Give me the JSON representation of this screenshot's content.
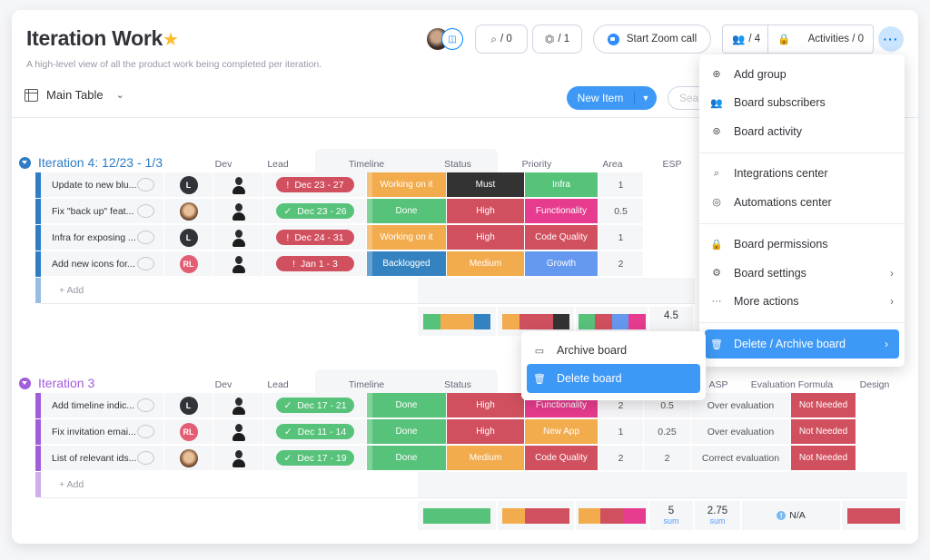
{
  "board": {
    "title": "Iteration Work",
    "description": "A high-level view of all the product work being completed per iteration.",
    "view_label": "Main Table"
  },
  "header": {
    "integrations_count": "/ 0",
    "automations_count": "/ 1",
    "zoom_label": "Start Zoom call",
    "subscribers_count": "/ 4",
    "activities_label": "Activities / 0",
    "new_item_label": "New Item",
    "search_placeholder": "Search"
  },
  "columns": [
    "Dev",
    "Lead",
    "Timeline",
    "Status",
    "Priority",
    "Area",
    "ESP",
    "ASP",
    "Evaluation Formula",
    "Design"
  ],
  "colors": {
    "done": "#57c27a",
    "working": "#f2ab4d",
    "stuck": "#d1505f",
    "backlogged": "#3483c0",
    "must": "#333333",
    "growth": "#6598ef",
    "pink": "#e63b8e",
    "group4": "#2f7dc5",
    "group3": "#a25ddc"
  },
  "groups": [
    {
      "title": "Iteration 4: 12/23 - 1/3",
      "color": "#2f7dc5",
      "add_label": "+ Add",
      "rows": [
        {
          "name": "Update to new blu...",
          "dev": "L",
          "timeline": "Dec 23 - 27",
          "timeline_state": "!",
          "status": "Working on it",
          "priority": "Must",
          "area": "Infra",
          "esp": "1"
        },
        {
          "name": "Fix \"back up\" feat...",
          "dev": "photo",
          "timeline": "Dec 23 - 26",
          "timeline_state": "✓",
          "status": "Done",
          "priority": "High",
          "area": "Functionality",
          "esp": "0.5"
        },
        {
          "name": "Infra for exposing ...",
          "dev": "L",
          "timeline": "Dec 24 - 31",
          "timeline_state": "!",
          "status": "Working on it",
          "priority": "High",
          "area": "Code Quality",
          "esp": "1"
        },
        {
          "name": "Add new icons for...",
          "dev": "RL",
          "timeline": "Jan 1 - 3",
          "timeline_state": "!",
          "status": "Backlogged",
          "priority": "Medium",
          "area": "Growth",
          "esp": "2"
        }
      ],
      "summary": {
        "esp": "4.5"
      }
    },
    {
      "title": "Iteration 3",
      "color": "#a25ddc",
      "add_label": "+ Add",
      "rows": [
        {
          "name": "Add timeline indic...",
          "dev": "L",
          "timeline": "Dec 17 - 21",
          "timeline_state": "✓",
          "status": "Done",
          "priority": "High",
          "area": "Functionality",
          "esp": "2",
          "asp": "0.5",
          "evaluation": "Over evaluation",
          "design": "Not Needed"
        },
        {
          "name": "Fix invitation emai...",
          "dev": "RL",
          "timeline": "Dec 11 - 14",
          "timeline_state": "✓",
          "status": "Done",
          "priority": "High",
          "area": "New App",
          "esp": "1",
          "asp": "0.25",
          "evaluation": "Over evaluation",
          "design": "Not Needed"
        },
        {
          "name": "List of relevant ids...",
          "dev": "photo",
          "timeline": "Dec 17 - 19",
          "timeline_state": "✓",
          "status": "Done",
          "priority": "Medium",
          "area": "Code Quality",
          "esp": "2",
          "asp": "2",
          "evaluation": "Correct evaluation",
          "design": "Not Needed"
        }
      ],
      "summary": {
        "esp": "5",
        "esp_label": "sum",
        "asp": "2.75",
        "asp_label": "sum",
        "evaluation": "N/A"
      }
    }
  ],
  "menu": {
    "items": [
      {
        "icon": "plus-circle-icon",
        "glyph": "⊕",
        "label": "Add group"
      },
      {
        "icon": "subscribers-icon",
        "glyph": "👥",
        "label": "Board subscribers"
      },
      {
        "icon": "activity-icon",
        "glyph": "⊛",
        "label": "Board activity"
      },
      {
        "icon": "integrations-icon",
        "glyph": "⌕",
        "label": "Integrations center"
      },
      {
        "icon": "robot-icon",
        "glyph": "◎",
        "label": "Automations center"
      },
      {
        "icon": "lock-icon",
        "glyph": "🔒",
        "label": "Board permissions"
      },
      {
        "icon": "gear-icon",
        "glyph": "⚙",
        "label": "Board settings",
        "submenu": true
      },
      {
        "icon": "ellipsis-icon",
        "glyph": "···",
        "label": "More actions",
        "submenu": true
      },
      {
        "icon": "trash-icon",
        "glyph": "🗑",
        "label": "Delete / Archive board",
        "submenu": true,
        "active": true
      }
    ],
    "submenu": [
      {
        "icon": "archive-icon",
        "label": "Archive board"
      },
      {
        "icon": "trash-icon",
        "label": "Delete board",
        "active": true
      }
    ]
  }
}
